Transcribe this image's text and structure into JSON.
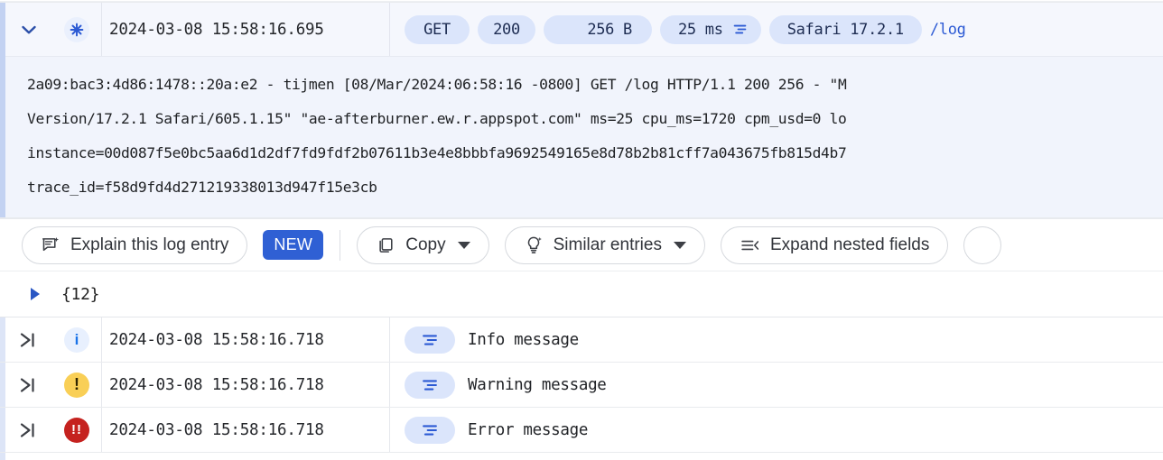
{
  "entry": {
    "expand_icon": "chevron-down-icon",
    "severity_icon": "asterisk-default-icon",
    "timestamp": "2024-03-08 15:58:16.695",
    "badges": {
      "method": "GET",
      "status": "200",
      "size": "256 B",
      "latency": "25 ms",
      "latency_icon": "align-lines-icon",
      "user_agent": "Safari 17.2.1"
    },
    "path": "/log",
    "body_lines": [
      "2a09:bac3:4d86:1478::20a:e2 - tijmen [08/Mar/2024:06:58:16 -0800] GET /log HTTP/1.1 200 256 - \"M",
      "Version/17.2.1 Safari/605.1.15\" \"ae-afterburner.ew.r.appspot.com\" ms=25 cpu_ms=1720 cpm_usd=0 lo",
      "instance=00d087f5e0bc5aa6d1d2df7fd9fdf2b07611b3e4e8bbbfa9692549165e8d78b2b81cff7a043675fb815d4b7",
      "trace_id=f58d9fd4d271219338013d947f15e3cb"
    ]
  },
  "toolbar": {
    "explain_label": "Explain this log entry",
    "explain_icon": "chat-sparkle-icon",
    "new_badge": "NEW",
    "copy_label": "Copy",
    "copy_icon": "copy-icon",
    "similar_label": "Similar entries",
    "similar_icon": "lightbulb-sparkle-icon",
    "expand_nested_label": "Expand nested fields",
    "expand_nested_icon": "collapse-lines-icon"
  },
  "nested_fields": {
    "toggle_icon": "triangle-right-icon",
    "label": "{12}"
  },
  "rows": [
    {
      "expand_icon": "expand-row-icon",
      "severity": "info",
      "severity_icon": "info-icon",
      "severity_glyph": "i",
      "severity_color": "#1a73e8",
      "severity_bg": "#e8f0fe",
      "timestamp": "2024-03-08 15:58:16.718",
      "summary_icon": "align-lines-icon",
      "message": "Info message"
    },
    {
      "expand_icon": "expand-row-icon",
      "severity": "warning",
      "severity_icon": "warning-icon",
      "severity_glyph": "!",
      "severity_color": "#3c2f00",
      "severity_bg": "#f9cf56",
      "timestamp": "2024-03-08 15:58:16.718",
      "summary_icon": "align-lines-icon",
      "message": "Warning message"
    },
    {
      "expand_icon": "expand-row-icon",
      "severity": "error",
      "severity_icon": "error-icon",
      "severity_glyph": "!!",
      "severity_color": "#ffffff",
      "severity_bg": "#c5221f",
      "timestamp": "2024-03-08 15:58:16.718",
      "summary_icon": "align-lines-icon",
      "message": "Error message"
    }
  ],
  "colors": {
    "accent_bar": "#c3d2f2",
    "entry_bg": "#f1f4fc",
    "badge_bg": "#dbe5fb",
    "badge_text": "#1d2c52",
    "link": "#2c5ad4",
    "new_badge_bg": "#2f60d4"
  }
}
